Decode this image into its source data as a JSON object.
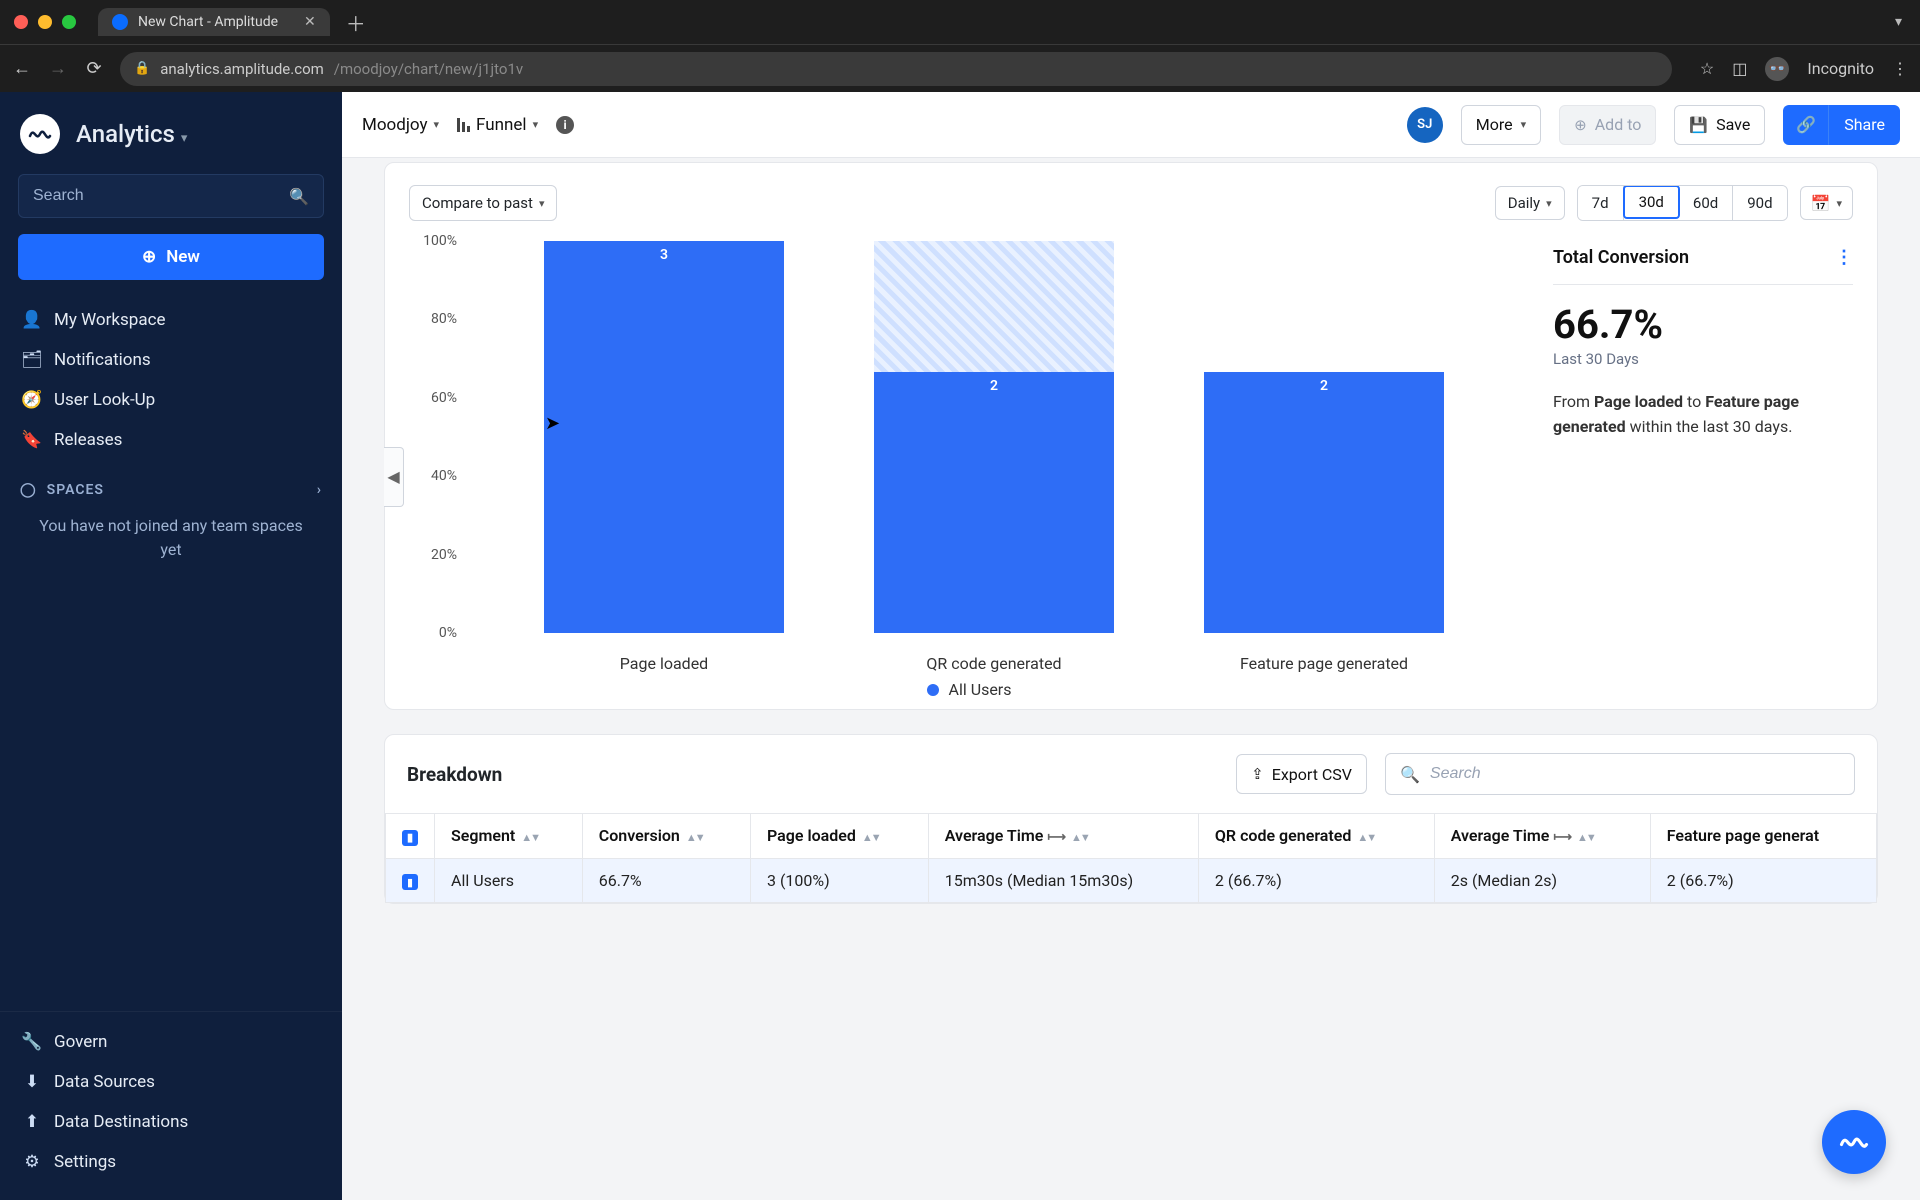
{
  "browser": {
    "tab_title": "New Chart - Amplitude",
    "url_host": "analytics.amplitude.com",
    "url_path": "/moodjoy/chart/new/j1jto1v",
    "incognito_label": "Incognito"
  },
  "sidebar": {
    "brand": "Analytics",
    "search_placeholder": "Search",
    "new_button": "New",
    "items": [
      {
        "label": "My Workspace"
      },
      {
        "label": "Notifications"
      },
      {
        "label": "User Look-Up"
      },
      {
        "label": "Releases"
      }
    ],
    "spaces_header": "SPACES",
    "spaces_empty": "You have not joined any team spaces yet",
    "bottom": [
      {
        "label": "Govern"
      },
      {
        "label": "Data Sources"
      },
      {
        "label": "Data Destinations"
      },
      {
        "label": "Settings"
      }
    ]
  },
  "topbar": {
    "workspace": "Moodjoy",
    "chart_type": "Funnel",
    "avatar": "SJ",
    "more": "More",
    "addto": "Add to",
    "save": "Save",
    "share": "Share"
  },
  "controls": {
    "compare": "Compare to past",
    "granularity": "Daily",
    "ranges": [
      "7d",
      "30d",
      "60d",
      "90d"
    ],
    "active_range": "30d"
  },
  "chart_data": {
    "type": "bar",
    "categories": [
      "Page loaded",
      "QR code generated",
      "Feature page generated"
    ],
    "values": [
      100,
      66.7,
      66.7
    ],
    "counts": [
      3,
      2,
      2
    ],
    "dropoff_from_prev_pct": [
      0,
      33.3,
      0
    ],
    "ylabel": "",
    "ylim": [
      0,
      100
    ],
    "yticks": [
      "0%",
      "20%",
      "40%",
      "60%",
      "80%",
      "100%"
    ],
    "series_name": "All Users"
  },
  "metric": {
    "title": "Total Conversion",
    "value": "66.7%",
    "subtitle": "Last 30 Days",
    "desc_prefix": "From ",
    "desc_from": "Page loaded",
    "desc_mid": " to ",
    "desc_to": "Feature page generated",
    "desc_suffix": " within the last 30 days."
  },
  "breakdown": {
    "title": "Breakdown",
    "export": "Export CSV",
    "search_placeholder": "Search",
    "columns": [
      "",
      "Segment",
      "Conversion",
      "Page loaded",
      "Average Time",
      "QR code generated",
      "Average Time",
      "Feature page generat"
    ],
    "row": {
      "segment": "All Users",
      "conversion": "66.7%",
      "page_loaded": "3 (100%)",
      "avg1": "15m30s (Median 15m30s)",
      "qr": "2 (66.7%)",
      "avg2": "2s (Median 2s)",
      "feature": "2 (66.7%)"
    }
  }
}
